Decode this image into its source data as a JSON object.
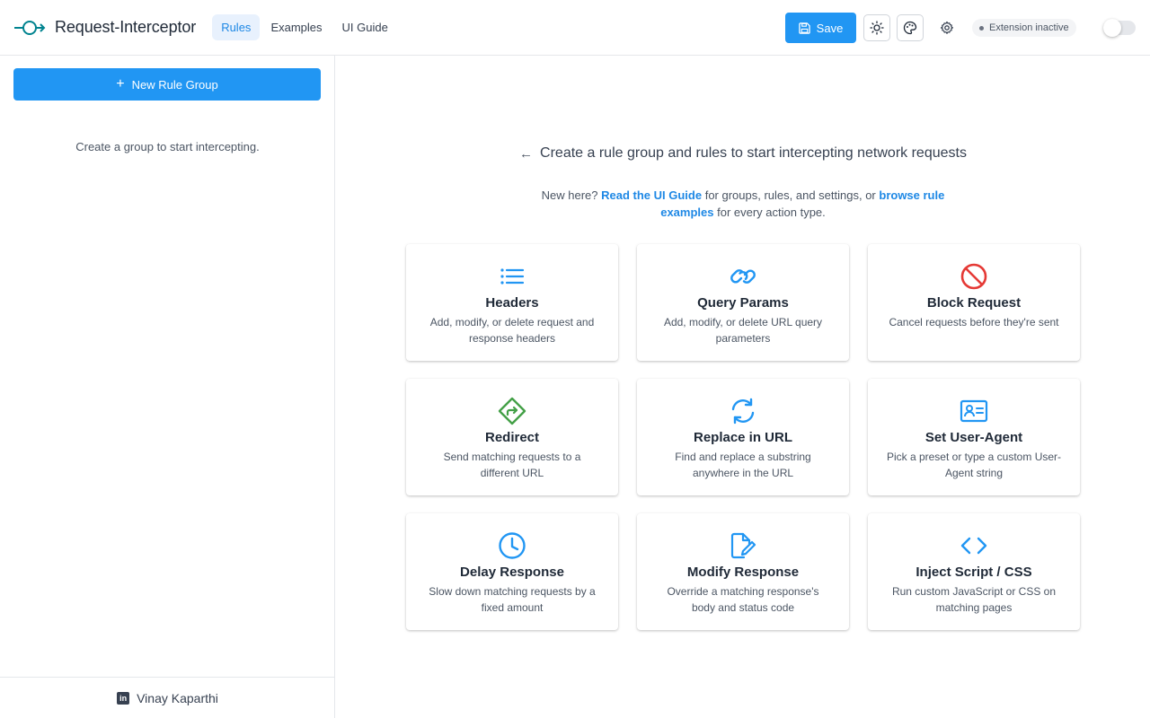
{
  "header": {
    "app_title": "Request-Interceptor",
    "tabs": [
      {
        "label": "Rules",
        "active": true
      },
      {
        "label": "Examples",
        "active": false
      },
      {
        "label": "UI Guide",
        "active": false
      }
    ],
    "save_label": "Save",
    "status_text": "Extension inactive",
    "extension_enabled": false
  },
  "sidebar": {
    "new_group_label": "New Rule Group",
    "empty_text": "Create a group to start intercepting.",
    "footer_name": "Vinay Kaparthi"
  },
  "main": {
    "heading": "Create a rule group and rules to start intercepting network requests",
    "help": {
      "prefix": "New here? ",
      "guide_link": "Read the UI Guide",
      "middle": " for groups, rules, and settings, or ",
      "examples_link": "browse rule examples",
      "suffix": " for every action type."
    },
    "cards": [
      {
        "title": "Headers",
        "desc": "Add, modify, or delete request and response headers",
        "icon": "list-icon"
      },
      {
        "title": "Query Params",
        "desc": "Add, modify, or delete URL query parameters",
        "icon": "link-icon"
      },
      {
        "title": "Block Request",
        "desc": "Cancel requests before they're sent",
        "icon": "block-icon"
      },
      {
        "title": "Redirect",
        "desc": "Send matching requests to a different URL",
        "icon": "redirect-icon"
      },
      {
        "title": "Replace in URL",
        "desc": "Find and replace a substring anywhere in the URL",
        "icon": "refresh-icon"
      },
      {
        "title": "Set User-Agent",
        "desc": "Pick a preset or type a custom User-Agent string",
        "icon": "id-card-icon"
      },
      {
        "title": "Delay Response",
        "desc": "Slow down matching requests by a fixed amount",
        "icon": "clock-icon"
      },
      {
        "title": "Modify Response",
        "desc": "Override a matching response's body and status code",
        "icon": "edit-document-icon"
      },
      {
        "title": "Inject Script / CSS",
        "desc": "Run custom JavaScript or CSS on matching pages",
        "icon": "code-icon"
      }
    ]
  },
  "colors": {
    "accent": "#2196f3",
    "logo": "#00838f",
    "block": "#e53935",
    "redirect": "#43a047"
  }
}
